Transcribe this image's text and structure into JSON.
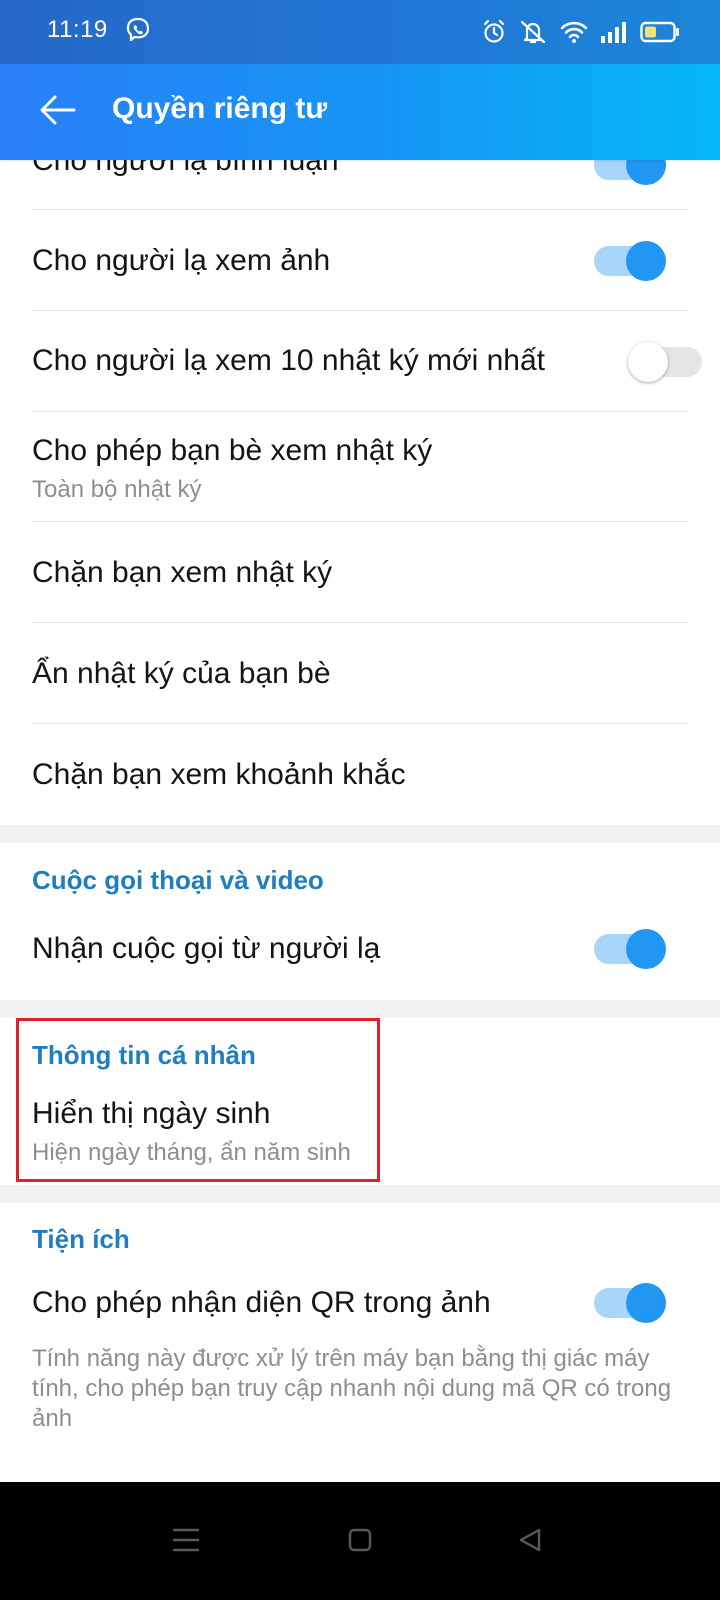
{
  "status_bar": {
    "time": "11:19",
    "icons": [
      "viber-icon",
      "alarm-icon",
      "mute-icon",
      "wifi-icon",
      "signal-icon",
      "battery-icon"
    ]
  },
  "app_bar": {
    "title": "Quyền riêng tư",
    "back_icon": "arrow-left-icon"
  },
  "rows": {
    "comment": {
      "label": "Cho người lạ bình luận",
      "toggle_on": true
    },
    "photos": {
      "label": "Cho người lạ xem ảnh",
      "toggle_on": true
    },
    "ten_diary": {
      "label": "Cho người lạ xem 10 nhật ký mới nhất",
      "toggle_on": false
    },
    "friends_diary": {
      "label": "Cho phép bạn bè xem nhật ký",
      "sub": "Toàn bộ nhật ký"
    },
    "block_diary": {
      "label": "Chặn bạn xem nhật ký"
    },
    "hide_diary": {
      "label": "Ẩn nhật ký của bạn bè"
    },
    "block_moments": {
      "label": "Chặn bạn xem khoảnh khắc"
    }
  },
  "sections": {
    "calls": {
      "title": "Cuộc gọi thoại và video",
      "row_label": "Nhận cuộc gọi từ người lạ",
      "toggle_on": true
    },
    "personal": {
      "title": "Thông tin cá nhân",
      "row_label": "Hiển thị ngày sinh",
      "row_sub": "Hiện ngày tháng, ẩn năm sinh"
    },
    "utilities": {
      "title": "Tiện ích",
      "row_label": "Cho phép nhận diện QR trong ảnh",
      "toggle_on": true,
      "description": "Tính năng này được xử lý trên máy bạn bằng thị giác máy tính, cho phép bạn truy cập nhanh nội dung mã QR có trong ảnh"
    }
  },
  "nav_bar": [
    "menu-icon",
    "home-icon",
    "back-icon"
  ],
  "colors": {
    "accent": "#2196f3",
    "section_title": "#1f7dc2",
    "highlight_border": "#e0202b",
    "app_bar_start": "#2a7ff7",
    "app_bar_end": "#05b8f6"
  }
}
